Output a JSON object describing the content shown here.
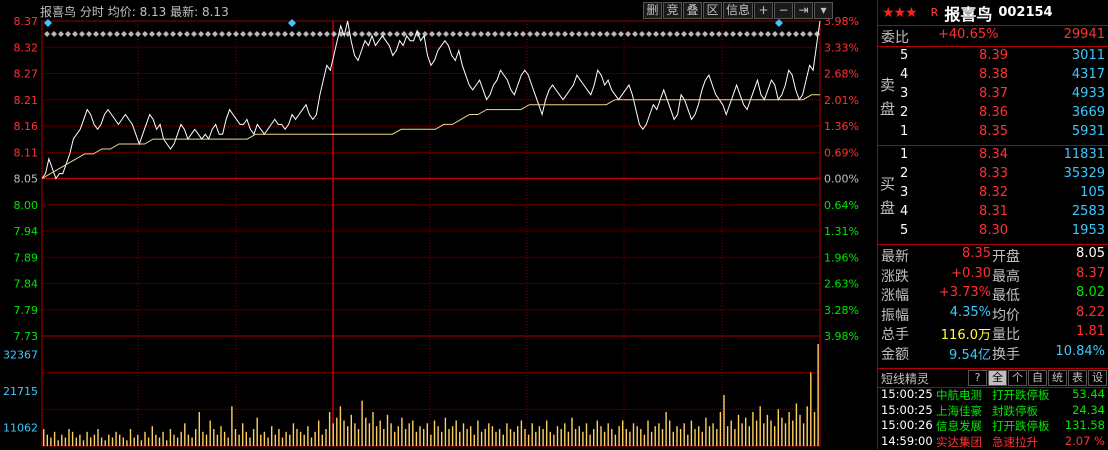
{
  "header": {
    "stock_name": "报喜鸟",
    "view": "分时",
    "avg_label": "均价:",
    "avg_value": "8.13",
    "last_label": "最新:",
    "last_value": "8.13"
  },
  "toolbar": [
    "删",
    "竞",
    "叠",
    "区",
    "信息",
    "+",
    "−",
    "⇥",
    "▾"
  ],
  "chart_data": {
    "type": "line",
    "price_axis_labels": [
      "8.37",
      "8.32",
      "8.27",
      "8.21",
      "8.16",
      "8.11",
      "8.05",
      "8.00",
      "7.94",
      "7.89",
      "7.84",
      "7.79",
      "7.73"
    ],
    "pct_axis_labels": [
      "3.98%",
      "3.33%",
      "2.68%",
      "2.01%",
      "1.36%",
      "0.69%",
      "0.00%",
      "0.64%",
      "1.31%",
      "1.96%",
      "2.63%",
      "3.28%",
      "3.98%"
    ],
    "ylim": [
      7.73,
      8.37
    ],
    "prev_close": 8.05,
    "volume_axis_labels": [
      "32367",
      "21715",
      "11062"
    ],
    "volume_max": 32367,
    "series": [
      {
        "name": "price",
        "values": [
          8.05,
          8.06,
          8.09,
          8.07,
          8.05,
          8.06,
          8.06,
          8.08,
          8.1,
          8.13,
          8.14,
          8.15,
          8.17,
          8.19,
          8.18,
          8.16,
          8.15,
          8.16,
          8.18,
          8.19,
          8.18,
          8.17,
          8.16,
          8.17,
          8.18,
          8.17,
          8.16,
          8.14,
          8.12,
          8.14,
          8.16,
          8.18,
          8.17,
          8.15,
          8.16,
          8.13,
          8.12,
          8.11,
          8.12,
          8.14,
          8.16,
          8.15,
          8.13,
          8.14,
          8.15,
          8.14,
          8.13,
          8.14,
          8.13,
          8.15,
          8.16,
          8.14,
          8.14,
          8.17,
          8.19,
          8.18,
          8.17,
          8.16,
          8.16,
          8.17,
          8.15,
          8.14,
          8.16,
          8.15,
          8.14,
          8.15,
          8.16,
          8.17,
          8.16,
          8.16,
          8.15,
          8.16,
          8.18,
          8.17,
          8.18,
          8.19,
          8.2,
          8.18,
          8.17,
          8.18,
          8.22,
          8.25,
          8.28,
          8.27,
          8.3,
          8.33,
          8.36,
          8.34,
          8.37,
          8.33,
          8.3,
          8.29,
          8.31,
          8.33,
          8.32,
          8.34,
          8.32,
          8.33,
          8.34,
          8.33,
          8.32,
          8.3,
          8.31,
          8.33,
          8.32,
          8.34,
          8.33,
          8.33,
          8.35,
          8.33,
          8.34,
          8.3,
          8.28,
          8.29,
          8.31,
          8.32,
          8.33,
          8.32,
          8.3,
          8.29,
          8.31,
          8.28,
          8.26,
          8.24,
          8.23,
          8.24,
          8.25,
          8.23,
          8.21,
          8.22,
          8.24,
          8.25,
          8.27,
          8.26,
          8.25,
          8.23,
          8.22,
          8.24,
          8.26,
          8.27,
          8.26,
          8.24,
          8.22,
          8.2,
          8.18,
          8.21,
          8.23,
          8.24,
          8.23,
          8.22,
          8.21,
          8.22,
          8.23,
          8.24,
          8.26,
          8.25,
          8.24,
          8.23,
          8.22,
          8.24,
          8.27,
          8.26,
          8.24,
          8.25,
          8.23,
          8.22,
          8.21,
          8.22,
          8.23,
          8.24,
          8.22,
          8.19,
          8.16,
          8.15,
          8.16,
          8.18,
          8.2,
          8.19,
          8.21,
          8.23,
          8.21,
          8.19,
          8.17,
          8.18,
          8.22,
          8.21,
          8.19,
          8.17,
          8.18,
          8.2,
          8.23,
          8.25,
          8.26,
          8.24,
          8.22,
          8.21,
          8.2,
          8.18,
          8.2,
          8.22,
          8.24,
          8.22,
          8.2,
          8.19,
          8.21,
          8.23,
          8.25,
          8.22,
          8.21,
          8.23,
          8.25,
          8.24,
          8.21,
          8.22,
          8.24,
          8.27,
          8.26,
          8.23,
          8.21,
          8.22,
          8.25,
          8.28,
          8.27,
          8.32,
          8.37
        ],
        "color": "#ffffff"
      },
      {
        "name": "avg",
        "values": [
          8.05,
          8.06,
          8.07,
          8.08,
          8.09,
          8.1,
          8.1,
          8.11,
          8.11,
          8.12,
          8.12,
          8.12,
          8.12,
          8.13,
          8.13,
          8.13,
          8.13,
          8.13,
          8.13,
          8.13,
          8.13,
          8.13,
          8.13,
          8.13,
          8.13,
          8.14,
          8.14,
          8.14,
          8.14,
          8.14,
          8.14,
          8.14,
          8.14,
          8.14,
          8.14,
          8.14,
          8.14,
          8.14,
          8.14,
          8.14,
          8.14,
          8.14,
          8.15,
          8.15,
          8.15,
          8.15,
          8.15,
          8.16,
          8.16,
          8.17,
          8.18,
          8.18,
          8.19,
          8.19,
          8.19,
          8.19,
          8.19,
          8.2,
          8.2,
          8.2,
          8.2,
          8.2,
          8.2,
          8.2,
          8.2,
          8.2,
          8.2,
          8.21,
          8.21,
          8.21,
          8.21,
          8.21,
          8.21,
          8.21,
          8.21,
          8.21,
          8.21,
          8.21,
          8.21,
          8.21,
          8.21,
          8.21,
          8.21,
          8.21,
          8.21,
          8.21,
          8.21,
          8.21,
          8.21,
          8.21,
          8.22,
          8.22
        ],
        "color": "#e8d890"
      }
    ],
    "volume": [
      6,
      4,
      3,
      5,
      2,
      4,
      3,
      6,
      5,
      3,
      4,
      2,
      5,
      3,
      4,
      6,
      3,
      2,
      4,
      3,
      5,
      4,
      3,
      2,
      6,
      3,
      4,
      2,
      5,
      3,
      7,
      4,
      3,
      5,
      2,
      6,
      4,
      3,
      5,
      8,
      4,
      3,
      6,
      12,
      5,
      4,
      9,
      6,
      4,
      7,
      5,
      3,
      14,
      6,
      4,
      8,
      5,
      3,
      6,
      10,
      4,
      5,
      3,
      7,
      4,
      6,
      3,
      5,
      4,
      8,
      6,
      5,
      4,
      7,
      3,
      5,
      9,
      4,
      6,
      12,
      8,
      10,
      14,
      9,
      7,
      11,
      8,
      6,
      16,
      10,
      8,
      12,
      7,
      9,
      6,
      11,
      8,
      5,
      7,
      10,
      6,
      8,
      9,
      5,
      7,
      6,
      8,
      4,
      9,
      7,
      5,
      10,
      6,
      7,
      9,
      5,
      8,
      6,
      7,
      4,
      9,
      5,
      6,
      8,
      7,
      5,
      6,
      4,
      8,
      6,
      5,
      7,
      9,
      6,
      4,
      8,
      5,
      7,
      6,
      9,
      5,
      4,
      7,
      6,
      8,
      5,
      10,
      6,
      7,
      5,
      8,
      4,
      6,
      9,
      7,
      5,
      8,
      6,
      4,
      7,
      9,
      6,
      5,
      8,
      7,
      6,
      4,
      9,
      5,
      7,
      8,
      6,
      12,
      9,
      5,
      7,
      6,
      8,
      4,
      9,
      6,
      7,
      5,
      10,
      7,
      8,
      6,
      12,
      18,
      7,
      9,
      6,
      11,
      8,
      10,
      7,
      12,
      9,
      14,
      8,
      11,
      9,
      7,
      13,
      10,
      8,
      12,
      9,
      15,
      11,
      8,
      14,
      26,
      12,
      36
    ]
  },
  "panel": {
    "stars": "★★★",
    "flag": "R",
    "name": "报喜鸟",
    "code": "002154",
    "weibi_label": "委比",
    "weibi_pct": "+40.65%",
    "weibi_num": "29941",
    "sell_label": [
      "卖",
      "盘"
    ],
    "buy_label": [
      "买",
      "盘"
    ],
    "sell": [
      {
        "lvl": "5",
        "price": "8.39",
        "vol": "3011"
      },
      {
        "lvl": "4",
        "price": "8.38",
        "vol": "4317"
      },
      {
        "lvl": "3",
        "price": "8.37",
        "vol": "4933"
      },
      {
        "lvl": "2",
        "price": "8.36",
        "vol": "3669"
      },
      {
        "lvl": "1",
        "price": "8.35",
        "vol": "5931"
      }
    ],
    "buy": [
      {
        "lvl": "1",
        "price": "8.34",
        "vol": "11831"
      },
      {
        "lvl": "2",
        "price": "8.33",
        "vol": "35329"
      },
      {
        "lvl": "3",
        "price": "8.32",
        "vol": "105"
      },
      {
        "lvl": "4",
        "price": "8.31",
        "vol": "2583"
      },
      {
        "lvl": "5",
        "price": "8.30",
        "vol": "1953"
      }
    ],
    "stats": [
      {
        "l1": "最新",
        "v1": "8.35",
        "c1": "red",
        "l2": "开盘",
        "v2": "8.05",
        "c2": "white"
      },
      {
        "l1": "涨跌",
        "v1": "+0.30",
        "c1": "red",
        "l2": "最高",
        "v2": "8.37",
        "c2": "red"
      },
      {
        "l1": "涨幅",
        "v1": "+3.73%",
        "c1": "red",
        "l2": "最低",
        "v2": "8.02",
        "c2": "green"
      },
      {
        "l1": "振幅",
        "v1": "4.35%",
        "c1": "cyan",
        "l2": "均价",
        "v2": "8.22",
        "c2": "red"
      },
      {
        "l1": "总手",
        "v1": "116.0万",
        "c1": "yellow",
        "l2": "量比",
        "v2": "1.81",
        "c2": "red"
      },
      {
        "l1": "金额",
        "v1": "9.54亿",
        "c1": "cyan",
        "l2": "换手",
        "v2": "10.84%",
        "c2": "cyan"
      }
    ],
    "tabs_title": "短线精灵",
    "tabs": [
      "?",
      "全",
      "个",
      "自",
      "统",
      "表",
      "设"
    ],
    "news": [
      {
        "time": "15:00:25",
        "name": "中航电测",
        "event": "打开跌停板",
        "val": "53.44",
        "color": "green"
      },
      {
        "time": "15:00:25",
        "name": "上海佳豪",
        "event": "封跌停板",
        "val": "24.34",
        "color": "green"
      },
      {
        "time": "15:00:26",
        "name": "信息发展",
        "event": "打开跌停板",
        "val": "131.58",
        "color": "green"
      },
      {
        "time": "14:59:00",
        "name": "实达集团",
        "event": "急速拉升",
        "val": "2.07 %",
        "color": "red"
      }
    ]
  }
}
